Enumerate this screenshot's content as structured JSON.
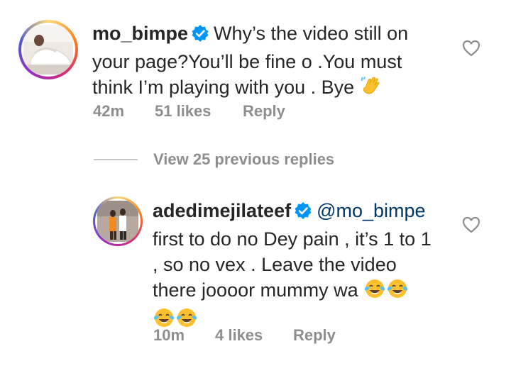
{
  "comments": [
    {
      "username": "mo_bimpe",
      "text": "Why’s the video still on your page?You’ll be fine o .You must think I’m playing with you . Bye",
      "emoji": "waving-hand",
      "time": "42m",
      "likes": "51 likes",
      "reply_label": "Reply"
    },
    {
      "username": "adedimejilateef",
      "mention": "@mo_bimpe",
      "text": "first to do no Dey pain , it’s 1 to 1 , so no vex . Leave the video there joooor mummy wa",
      "emojis": [
        "face-with-tears-of-joy",
        "face-with-tears-of-joy",
        "face-with-tears-of-joy",
        "face-with-tears-of-joy"
      ],
      "time": "10m",
      "likes": "4 likes",
      "reply_label": "Reply"
    }
  ],
  "view_replies": "View 25 previous replies",
  "colors": {
    "text": "#262626",
    "meta": "#8e8e8e",
    "verified": "#0095f6",
    "mention": "#00376b"
  }
}
